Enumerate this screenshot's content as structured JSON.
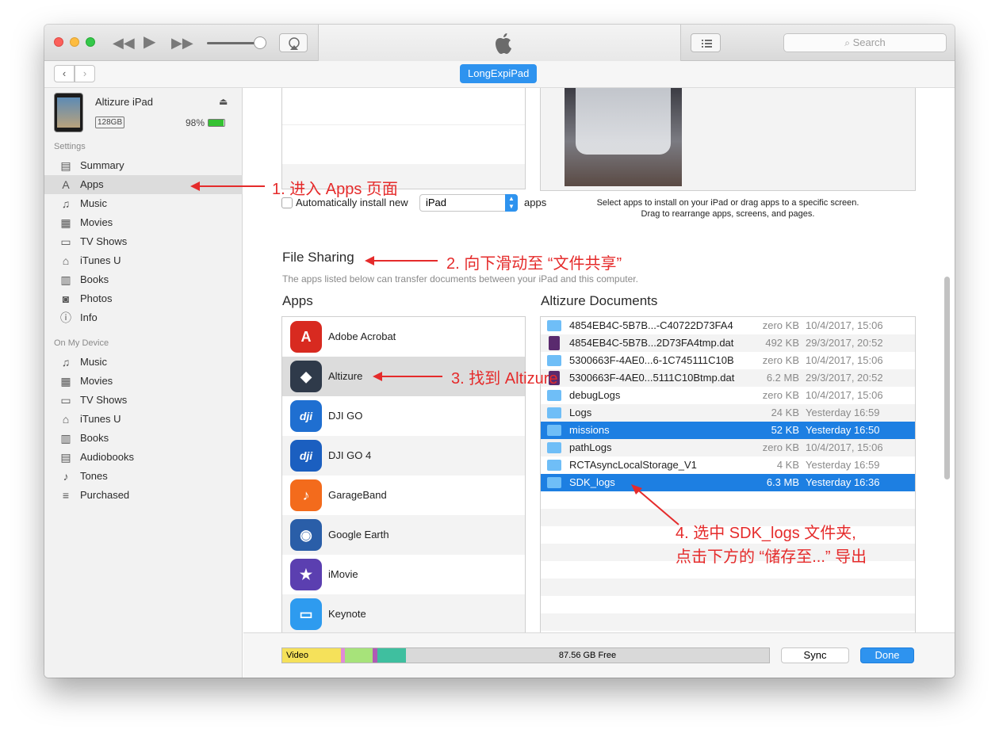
{
  "toolbar": {
    "search_placeholder": "Search",
    "back_label": "‹",
    "forward_label": "›",
    "device_tab": "LongExpiPad"
  },
  "device": {
    "name": "Altizure iPad",
    "capacity": "128GB",
    "battery": "98%"
  },
  "sidebar": {
    "settings_header": "Settings",
    "settings_items": [
      {
        "label": "Summary",
        "icon": "summary-icon",
        "glyph": "▤"
      },
      {
        "label": "Apps",
        "icon": "apps-icon",
        "glyph": "A"
      },
      {
        "label": "Music",
        "icon": "music-icon",
        "glyph": "♫"
      },
      {
        "label": "Movies",
        "icon": "movies-icon",
        "glyph": "▦"
      },
      {
        "label": "TV Shows",
        "icon": "tv-icon",
        "glyph": "▭"
      },
      {
        "label": "iTunes U",
        "icon": "itunes-u-icon",
        "glyph": "⌂"
      },
      {
        "label": "Books",
        "icon": "books-icon",
        "glyph": "▥"
      },
      {
        "label": "Photos",
        "icon": "photos-icon",
        "glyph": "◙"
      },
      {
        "label": "Info",
        "icon": "info-icon",
        "glyph": "ⓘ"
      }
    ],
    "device_header": "On My Device",
    "device_items": [
      {
        "label": "Music",
        "icon": "music-icon",
        "glyph": "♫"
      },
      {
        "label": "Movies",
        "icon": "movies-icon",
        "glyph": "▦"
      },
      {
        "label": "TV Shows",
        "icon": "tv-icon",
        "glyph": "▭"
      },
      {
        "label": "iTunes U",
        "icon": "itunes-u-icon",
        "glyph": "⌂"
      },
      {
        "label": "Books",
        "icon": "books-icon",
        "glyph": "▥"
      },
      {
        "label": "Audiobooks",
        "icon": "audiobooks-icon",
        "glyph": "▤"
      },
      {
        "label": "Tones",
        "icon": "tones-icon",
        "glyph": "♪"
      },
      {
        "label": "Purchased",
        "icon": "purchased-icon",
        "glyph": "≡"
      }
    ]
  },
  "install": {
    "auto_label": "Automatically install new",
    "device_select": "iPad",
    "apps_suffix": "apps",
    "hint_line1": "Select apps to install on your iPad or drag apps to a specific screen.",
    "hint_line2": "Drag to rearrange apps, screens, and pages."
  },
  "file_sharing": {
    "title": "File Sharing",
    "description": "The apps listed below can transfer documents between your iPad and this computer.",
    "apps_header": "Apps",
    "docs_header": "Altizure Documents",
    "apps": [
      {
        "name": "Adobe Acrobat",
        "glyph": "A",
        "color": "#d82a20"
      },
      {
        "name": "Altizure",
        "glyph": "◆",
        "color": "#2f3a4a"
      },
      {
        "name": "DJI GO",
        "glyph": "dji",
        "color": "#1f6fd1"
      },
      {
        "name": "DJI GO 4",
        "glyph": "dji",
        "color": "#1b5fc0"
      },
      {
        "name": "GarageBand",
        "glyph": "♪",
        "color": "#f36b1c"
      },
      {
        "name": "Google Earth",
        "glyph": "◉",
        "color": "#2a5ea8"
      },
      {
        "name": "iMovie",
        "glyph": "★",
        "color": "#5b3fb0"
      },
      {
        "name": "Keynote",
        "glyph": "▭",
        "color": "#2e9bef"
      }
    ],
    "documents": [
      {
        "name": "4854EB4C-5B7B...-C40722D73FA4",
        "size": "zero KB",
        "date": "10/4/2017, 15:06",
        "type": "folder"
      },
      {
        "name": "4854EB4C-5B7B...2D73FA4tmp.dat",
        "size": "492 KB",
        "date": "29/3/2017, 20:52",
        "type": "file"
      },
      {
        "name": "5300663F-4AE0...6-1C745111C10B",
        "size": "zero KB",
        "date": "10/4/2017, 15:06",
        "type": "folder"
      },
      {
        "name": "5300663F-4AE0...5111C10Btmp.dat",
        "size": "6.2 MB",
        "date": "29/3/2017, 20:52",
        "type": "file"
      },
      {
        "name": "debugLogs",
        "size": "zero KB",
        "date": "10/4/2017, 15:06",
        "type": "folder"
      },
      {
        "name": "Logs",
        "size": "24 KB",
        "date": "Yesterday 16:59",
        "type": "folder"
      },
      {
        "name": "missions",
        "size": "52 KB",
        "date": "Yesterday 16:50",
        "type": "folder"
      },
      {
        "name": "pathLogs",
        "size": "zero KB",
        "date": "10/4/2017, 15:06",
        "type": "folder"
      },
      {
        "name": "RCTAsyncLocalStorage_V1",
        "size": "4 KB",
        "date": "Yesterday 16:59",
        "type": "folder"
      },
      {
        "name": "SDK_logs",
        "size": "6.3 MB",
        "date": "Yesterday 16:36",
        "type": "folder"
      }
    ]
  },
  "storage": {
    "video_label": "Video",
    "free_label": "87.56 GB Free",
    "colors": {
      "video": "#f5e15a",
      "pink": "#e08ad8",
      "green": "#a7e37a",
      "purple": "#b05bb5",
      "teal": "#3fbf9f"
    }
  },
  "buttons": {
    "sync": "Sync",
    "done": "Done"
  },
  "annotations": {
    "step1": "1. 进入 Apps 页面",
    "step2": "2. 向下滑动至 “文件共享”",
    "step3": "3. 找到 Altizure",
    "step4_line1": "4. 选中 SDK_logs 文件夹,",
    "step4_line2": "点击下方的 “储存至...” 导出"
  },
  "colors": {
    "accent": "#1d7fe2",
    "annotation": "#e52b2b"
  }
}
